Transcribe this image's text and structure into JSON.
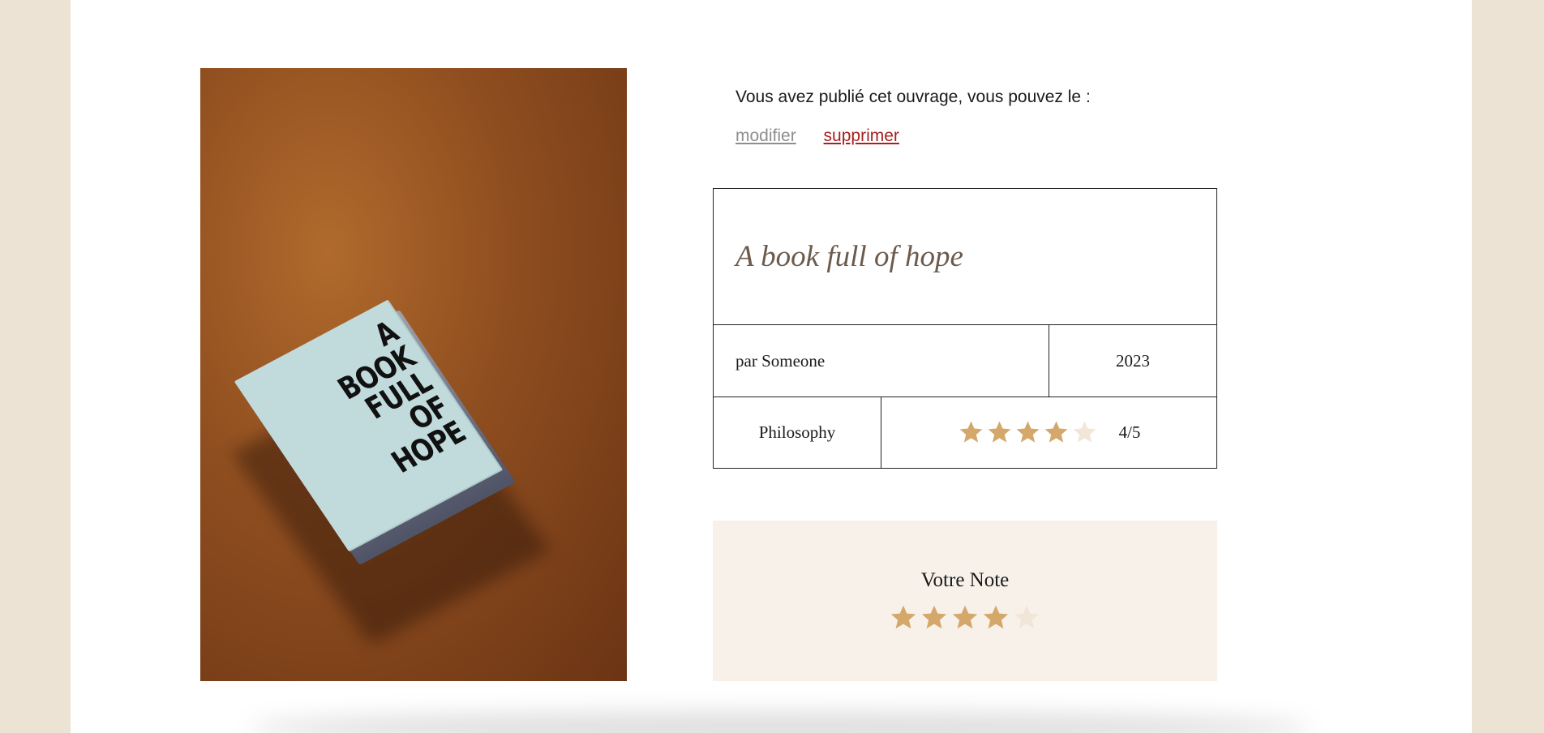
{
  "owner": {
    "message": "Vous avez publié cet ouvrage, vous pouvez le :",
    "edit_label": "modifier",
    "delete_label": "supprimer"
  },
  "book": {
    "cover_text": [
      "A",
      "BOOK",
      "FULL",
      "OF",
      "HOPE"
    ],
    "title": "A book full of hope",
    "author": "par Someone",
    "year": "2023",
    "genre": "Philosophy",
    "average_rating": 4,
    "rating_max": 5,
    "rating_label": "4/5"
  },
  "user_rating": {
    "title": "Votre Note",
    "value": 4,
    "max": 5
  },
  "colors": {
    "star_filled": "#d4a86a",
    "star_empty": "#f2e6d8",
    "title_color": "#6c5b4d",
    "delete_color": "#a82020",
    "edit_color": "#8e8e8e",
    "side_background": "#ede3d4",
    "rating_box_background": "#f7f1ea"
  }
}
